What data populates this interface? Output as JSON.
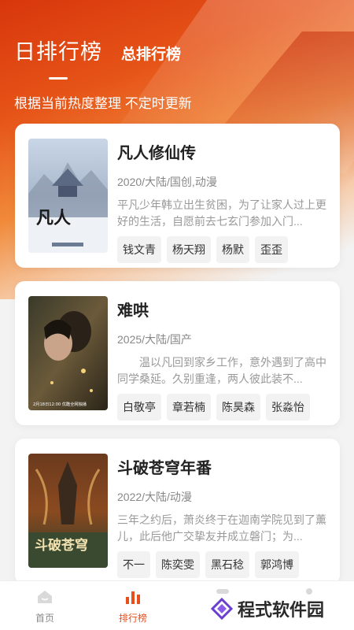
{
  "header": {
    "tab_daily": "日排行榜",
    "tab_total": "总排行榜",
    "subtitle": "根据当前热度整理 不定时更新"
  },
  "items": [
    {
      "title": "凡人修仙传",
      "meta": "2020/大陆/国创,动漫",
      "desc": "平凡少年韩立出生贫困，为了让家人过上更好的生活，自愿前去七玄门参加入门...",
      "tags": [
        "钱文青",
        "杨天翔",
        "杨默",
        "歪歪"
      ],
      "poster_text": "凡人"
    },
    {
      "title": "难哄",
      "meta": "2025/大陆/国产",
      "desc": "温以凡回到家乡工作，意外遇到了高中同学桑延。久别重逢，两人彼此装不...",
      "tags": [
        "白敬亭",
        "章若楠",
        "陈昊森",
        "张淼怡"
      ],
      "poster_text": "2月18日12:00 优酷全网独播"
    },
    {
      "title": "斗破苍穹年番",
      "meta": "2022/大陆/动漫",
      "desc": "三年之约后，萧炎终于在迦南学院见到了薰儿，此后他广交挚友并成立磐门；为...",
      "tags": [
        "不一",
        "陈奕雯",
        "黑石稔",
        "郭鸿博"
      ],
      "poster_text": "斗破苍穹"
    }
  ],
  "nav": {
    "home": "首页",
    "ranking": "排行榜"
  },
  "watermark": "程式软件园",
  "colors": {
    "accent": "#e7501c",
    "hero_start": "#d8360c",
    "hero_mid": "#f08a3a"
  }
}
